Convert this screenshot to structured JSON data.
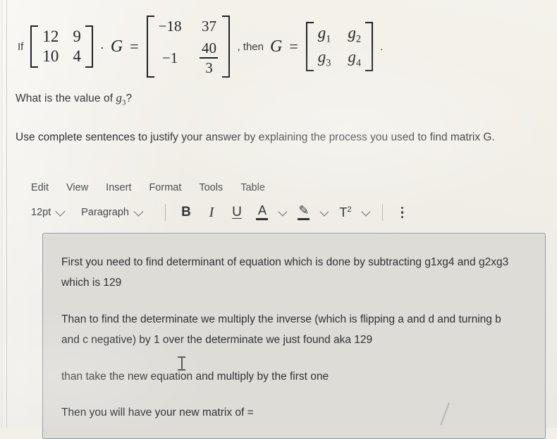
{
  "question": {
    "prefix": "If",
    "matrix_a": {
      "rows": [
        [
          "12",
          "9"
        ],
        [
          "10",
          "4"
        ]
      ]
    },
    "operator_dot": "·",
    "variable_g": "G",
    "equals": "=",
    "matrix_b": {
      "r0c0": "−18",
      "r0c1": "37",
      "r1c0": "−1",
      "r1c1_num": "40",
      "r1c1_den": "3"
    },
    "comma_then": ", then",
    "variable_g2": "G",
    "equals2": "=",
    "matrix_g": {
      "r0c0": "g",
      "r0c0_sub": "1",
      "r0c1": "g",
      "r0c1_sub": "2",
      "r1c0": "g",
      "r1c0_sub": "3",
      "r1c1": "g",
      "r1c1_sub": "4"
    },
    "period": ".",
    "prompt_prefix": "What is the value of ",
    "prompt_var": "g",
    "prompt_var_sub": "3",
    "prompt_suffix": "?",
    "instructions": "Use complete sentences to justify your answer by explaining the process you used to find matrix G."
  },
  "editor": {
    "menu": [
      {
        "label": "Edit"
      },
      {
        "label": "View"
      },
      {
        "label": "Insert"
      },
      {
        "label": "Format"
      },
      {
        "label": "Tools"
      },
      {
        "label": "Table"
      }
    ],
    "toolbar": {
      "font_size": "12pt",
      "block_format": "Paragraph",
      "bold_label": "B",
      "italic_label": "I",
      "underline_label": "U",
      "text_color_label": "A",
      "highlight_label": "✎",
      "superscript_label": "T",
      "superscript_exp": "2",
      "more_options_label": "⋮"
    },
    "content": {
      "paragraphs": [
        "First you need to find determinant of equation which is done by subtracting g1xg4 and g2xg3 which is 129",
        "Than to find the determinate we multiply the inverse (which is flipping a and d and turning b and c negative) by 1 over the determinate we just found aka 129",
        "than take the new equation and multiply by the first one",
        "Then you will have your new matrix of ="
      ]
    }
  },
  "colors": {
    "page_background": "#f1eee8",
    "editor_background": "#dedcd7",
    "editor_border": "#8b9bae",
    "text": "#2e3135"
  }
}
